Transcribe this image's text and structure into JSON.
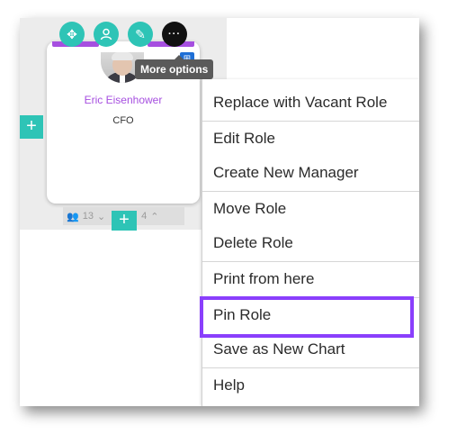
{
  "card": {
    "name": "Eric Eisenhower",
    "title": "CFO",
    "team_count": "13",
    "reports_count": "4"
  },
  "card_actions": [
    {
      "name": "move-icon",
      "glyph": "✥"
    },
    {
      "name": "user-icon",
      "glyph": "👤"
    },
    {
      "name": "pencil-icon",
      "glyph": "✎"
    },
    {
      "name": "more-options-icon",
      "glyph": "···"
    }
  ],
  "tooltip": "More options",
  "add_glyph": "+",
  "menu": {
    "items": [
      "Replace with Vacant Role",
      "Edit Role",
      "Create New Manager",
      "Move Role",
      "Delete Role",
      "Print from here",
      "Pin Role",
      "Save as New Chart",
      "Help"
    ],
    "highlighted": "Pin Role"
  },
  "colors": {
    "accent_purple": "#a64fe0",
    "action_teal": "#2ec4b6",
    "highlight_border": "#8a3ffc"
  }
}
